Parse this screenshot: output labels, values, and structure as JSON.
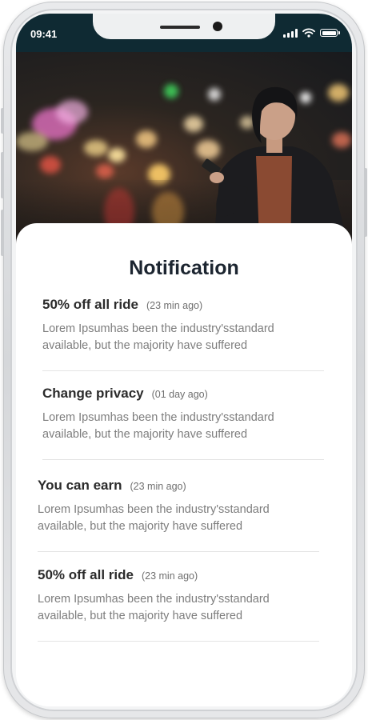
{
  "status_bar": {
    "time": "09:41",
    "icons": [
      "signal-icon",
      "wifi-icon",
      "battery-icon"
    ],
    "background_color": "#0f2a33"
  },
  "hero_image": {
    "description_icon": "photo-woman-with-phone-city-night"
  },
  "screen": {
    "title": "Notification"
  },
  "notifications": [
    {
      "title": "50% off all ride",
      "time": "(23 min ago)",
      "body": "Lorem Ipsumhas been the industry'sstandard available, but the majority have suffered"
    },
    {
      "title": "Change privacy",
      "time": "(01 day ago)",
      "body": "Lorem Ipsumhas been the industry'sstandard available, but the majority have suffered"
    },
    {
      "title": "You can earn",
      "time": "(23 min ago)",
      "body": "Lorem Ipsumhas been the industry'sstandard available, but the majority have suffered"
    },
    {
      "title": "50% off all ride",
      "time": "(23 min ago)",
      "body": "Lorem Ipsumhas been the industry'sstandard available, but the majority have suffered"
    }
  ],
  "colors": {
    "title": "#1c2530",
    "item_title": "#2b2b2b",
    "body_text": "#7d7d7d",
    "divider": "#e4e4e4"
  }
}
